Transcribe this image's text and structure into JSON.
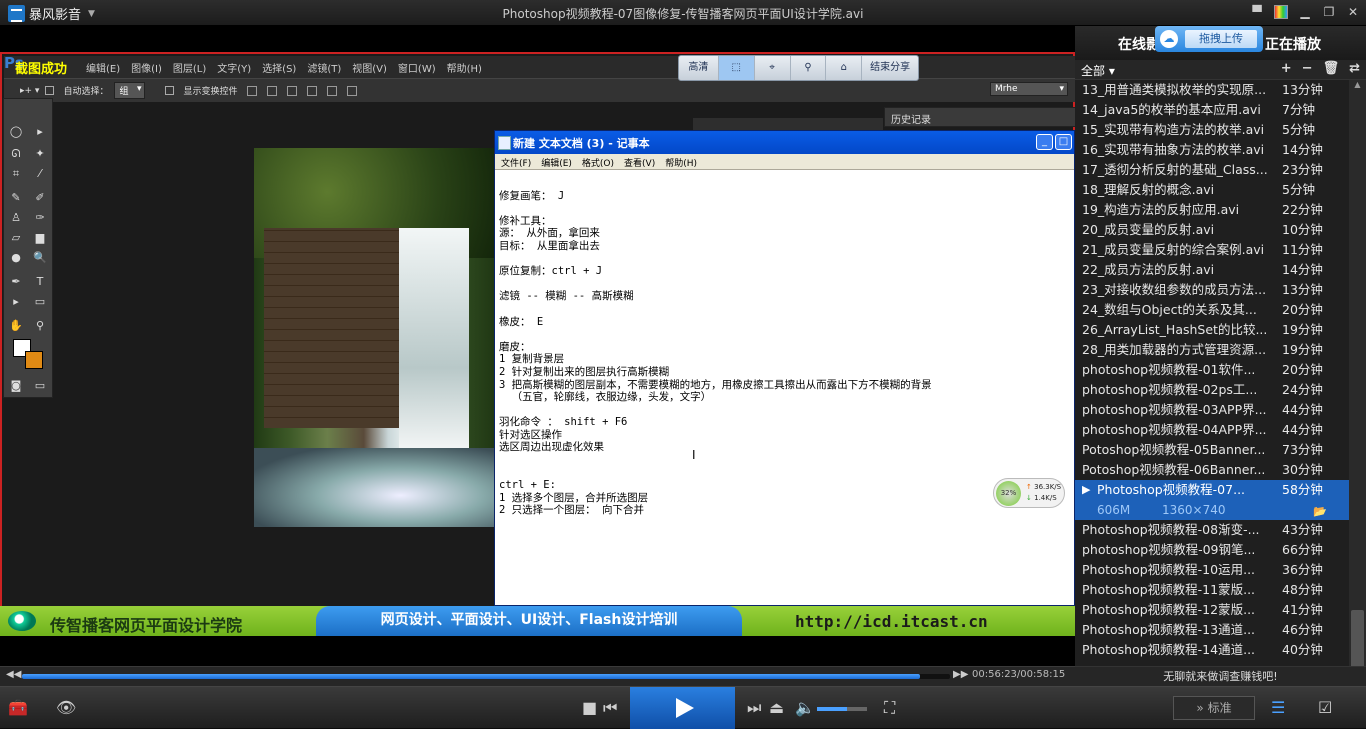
{
  "app": {
    "name": "暴风影音",
    "window_title": "Photoshop视频教程-07图像修复-传智播客网页平面UI设计学院.avi"
  },
  "overlay": {
    "snapshot_msg": "截图成功",
    "quality": "高清",
    "share": "结束分享"
  },
  "ps": {
    "logo": "Ps",
    "menu": [
      "编辑(E)",
      "图像(I)",
      "图层(L)",
      "文字(Y)",
      "选择(S)",
      "滤镜(T)",
      "视图(V)",
      "窗口(W)",
      "帮助(H)"
    ],
    "auto_select": "自动选择：",
    "group_value": "组",
    "show_transform": "显示变换控件",
    "workspace": "Mrhe",
    "history_panel": "历史记录"
  },
  "notepad": {
    "title": "新建 文本文档 (3) - 记事本",
    "menu": [
      "文件(F)",
      "编辑(E)",
      "格式(O)",
      "查看(V)",
      "帮助(H)"
    ],
    "content": "\n修复画笔： J\n\n修补工具：\n源： 从外面，拿回来\n目标： 从里面拿出去\n\n原位复制：ctrl + J\n\n滤镜 -- 模糊 -- 高斯模糊\n\n橡皮： E\n\n磨皮：\n1 复制背景层\n2 针对复制出来的图层执行高斯模糊\n3 把高斯模糊的图层副本，不需要模糊的地方，用橡皮擦工具擦出从而露出下方不模糊的背景\n  （五官，轮廓线，衣服边缘，头发，文字）\n\n羽化命令 ： shift + F6\n针对选区操作\n选区周边出现虚化效果\n\n\nctrl + E:\n1 选择多个图层，合并所选图层\n2 只选择一个图层： 向下合并"
  },
  "net": {
    "percent": "32%",
    "up": "36.3K/S",
    "down": "1.4K/S"
  },
  "banner": {
    "name": "传智播客网页平面设计学院",
    "courses": "网页设计、平面设计、UI设计、Flash设计培训",
    "url": "http://icd.itcast.cn"
  },
  "player": {
    "time": "00:56:23/00:58:15",
    "progress": 0.968,
    "volume": 0.6,
    "standard_btn": "标准"
  },
  "panel": {
    "tab_online": "在线影视",
    "upload": "拖拽上传",
    "tab_playing": "正在播放",
    "filter": "全部",
    "footer": "无聊就来做调查赚钱吧!",
    "items": [
      {
        "name": "13_用普通类模拟枚举的实现原...",
        "dur": "13分钟"
      },
      {
        "name": "14_java5的枚举的基本应用.avi",
        "dur": "7分钟"
      },
      {
        "name": "15_实现带有构造方法的枚举.avi",
        "dur": "5分钟"
      },
      {
        "name": "16_实现带有抽象方法的枚举.avi",
        "dur": "14分钟"
      },
      {
        "name": "17_透彻分析反射的基础_Class...",
        "dur": "23分钟"
      },
      {
        "name": "18_理解反射的概念.avi",
        "dur": "5分钟"
      },
      {
        "name": "19_构造方法的反射应用.avi",
        "dur": "22分钟"
      },
      {
        "name": "20_成员变量的反射.avi",
        "dur": "10分钟"
      },
      {
        "name": "21_成员变量反射的综合案例.avi",
        "dur": "11分钟"
      },
      {
        "name": "22_成员方法的反射.avi",
        "dur": "14分钟"
      },
      {
        "name": "23_对接收数组参数的成员方法...",
        "dur": "13分钟"
      },
      {
        "name": "24_数组与Object的关系及其...",
        "dur": "20分钟"
      },
      {
        "name": "26_ArrayList_HashSet的比较...",
        "dur": "19分钟"
      },
      {
        "name": "28_用类加载器的方式管理资源...",
        "dur": "19分钟"
      },
      {
        "name": "photoshop视频教程-01软件...",
        "dur": "20分钟"
      },
      {
        "name": "photoshop视频教程-02ps工...",
        "dur": "24分钟"
      },
      {
        "name": "photoshop视频教程-03APP界...",
        "dur": "44分钟"
      },
      {
        "name": "photoshop视频教程-04APP界...",
        "dur": "44分钟"
      },
      {
        "name": "Potoshop视频教程-05Banner...",
        "dur": "73分钟"
      },
      {
        "name": "Potoshop视频教程-06Banner...",
        "dur": "30分钟"
      }
    ],
    "current": {
      "name": "Photoshop视频教程-07...",
      "dur": "58分钟",
      "size": "606M",
      "res": "1360×740"
    },
    "after": [
      {
        "name": "Photoshop视频教程-08渐变-...",
        "dur": "43分钟"
      },
      {
        "name": "photoshop视频教程-09钢笔...",
        "dur": "66分钟"
      },
      {
        "name": "Photoshop视频教程-10运用...",
        "dur": "36分钟"
      },
      {
        "name": "Photoshop视频教程-11蒙版...",
        "dur": "48分钟"
      },
      {
        "name": "Photoshop视频教程-12蒙版...",
        "dur": "41分钟"
      },
      {
        "name": "Photoshop视频教程-13通道...",
        "dur": "46分钟"
      },
      {
        "name": "Photoshop视频教程-14通道...",
        "dur": "40分钟"
      }
    ]
  }
}
